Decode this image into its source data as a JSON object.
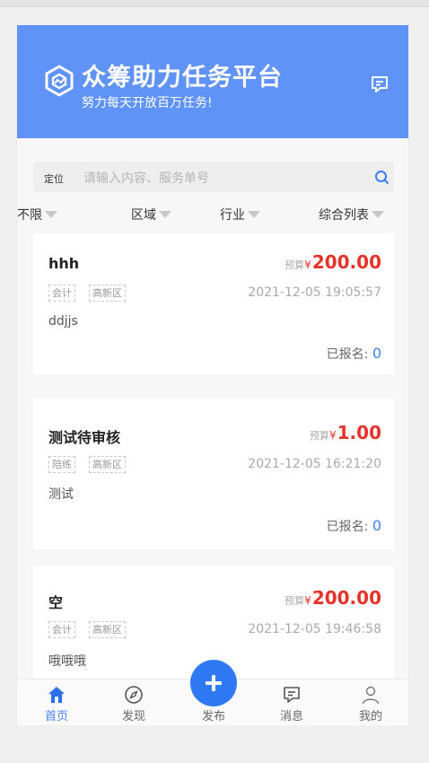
{
  "header": {
    "title": "众筹助力任务平台",
    "subtitle": "努力每天开放百万任务!",
    "logo_icon": "hexagon-logo-icon",
    "message_icon": "message-icon",
    "background": "#5f93f7"
  },
  "search": {
    "location_label": "定位",
    "placeholder": "请输入内容、服务单号",
    "icon": "search-icon"
  },
  "filters": [
    {
      "label": "不限"
    },
    {
      "label": "区域"
    },
    {
      "label": "行业"
    },
    {
      "label": "综合列表"
    }
  ],
  "tasks": [
    {
      "name": "hhh",
      "budget_label": "预算",
      "currency": "¥",
      "amount": "200.00",
      "tags": [
        "会计",
        "高新区"
      ],
      "time": "2021-12-05 19:05:57",
      "description": "ddjjs",
      "signup_label": "已报名:",
      "signup_count": "0"
    },
    {
      "name": "测试待审核",
      "budget_label": "预算",
      "currency": "¥",
      "amount": "1.00",
      "tags": [
        "陪练",
        "高新区"
      ],
      "time": "2021-12-05 16:21:20",
      "description": "测试",
      "signup_label": "已报名:",
      "signup_count": "0"
    },
    {
      "name": "空",
      "budget_label": "预算",
      "currency": "¥",
      "amount": "200.00",
      "tags": [
        "会计",
        "高新区"
      ],
      "time": "2021-12-05 19:46:58",
      "description": "哦哦哦"
    }
  ],
  "tabbar": {
    "active": "home",
    "accent": "#4a86f7",
    "items": [
      {
        "label": "首页",
        "icon": "home-icon"
      },
      {
        "label": "发现",
        "icon": "compass-icon"
      },
      {
        "label": "发布",
        "icon": "plus-icon"
      },
      {
        "label": "消息",
        "icon": "message-icon"
      },
      {
        "label": "我的",
        "icon": "user-icon"
      }
    ]
  }
}
